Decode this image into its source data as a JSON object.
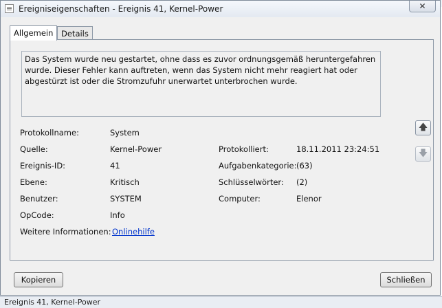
{
  "window": {
    "title": "Ereigniseigenschaften - Ereignis 41, Kernel-Power",
    "close_glyph": "✕"
  },
  "tabs": [
    {
      "label": "Allgemein",
      "active": true
    },
    {
      "label": "Details",
      "active": false
    }
  ],
  "description": "Das System wurde neu gestartet, ohne dass es zuvor ordnungsgemäß heruntergefahren wurde. Dieser Fehler kann auftreten, wenn das System nicht mehr reagiert hat oder abgestürzt ist oder die Stromzufuhr unerwartet unterbrochen wurde.",
  "fields": {
    "protokollname": {
      "label": "Protokollname:",
      "value": "System"
    },
    "quelle": {
      "label": "Quelle:",
      "value": "Kernel-Power"
    },
    "protokolliert": {
      "label": "Protokolliert:",
      "value": "18.11.2011 23:24:51"
    },
    "ereignis_id": {
      "label": "Ereignis-ID:",
      "value": "41"
    },
    "aufgabenkategorie": {
      "label": "Aufgabenkategorie:",
      "value": "(63)"
    },
    "ebene": {
      "label": "Ebene:",
      "value": "Kritisch"
    },
    "schluesselwoerter": {
      "label": "Schlüsselwörter:",
      "value": "(2)"
    },
    "benutzer": {
      "label": "Benutzer:",
      "value": "SYSTEM"
    },
    "computer": {
      "label": "Computer:",
      "value": "Elenor"
    },
    "opcode": {
      "label": "OpCode:",
      "value": "Info"
    },
    "weitere": {
      "label": "Weitere Informationen:",
      "link": "Onlinehilfe"
    }
  },
  "nav": {
    "up_glyph": "🡅",
    "down_glyph": "🡇"
  },
  "buttons": {
    "copy": "Kopieren",
    "close": "Schließen"
  },
  "taskbar_text": "Ereignis 41, Kernel-Power"
}
